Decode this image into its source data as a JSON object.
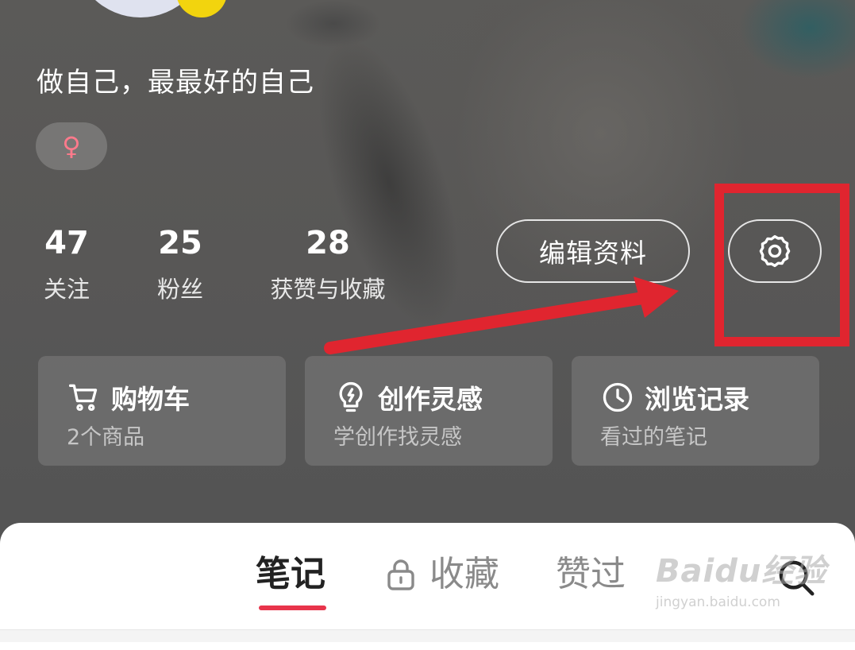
{
  "profile": {
    "bio": "做自己，最最好的自己",
    "gender_symbol": "♀",
    "gender_color": "#ff7a8c"
  },
  "stats": [
    {
      "value": "47",
      "label": "关注"
    },
    {
      "value": "25",
      "label": "粉丝"
    },
    {
      "value": "28",
      "label": "获赞与收藏"
    }
  ],
  "actions": {
    "edit_profile": "编辑资料",
    "settings_icon": "gear-icon"
  },
  "annotation": {
    "color": "#e0252f"
  },
  "cards": [
    {
      "icon": "cart-icon",
      "title": "购物车",
      "subtitle": "2个商品"
    },
    {
      "icon": "lightbulb-icon",
      "title": "创作灵感",
      "subtitle": "学创作找灵感"
    },
    {
      "icon": "clock-icon",
      "title": "浏览记录",
      "subtitle": "看过的笔记"
    }
  ],
  "tabs": {
    "notes": "笔记",
    "collections": "收藏",
    "liked": "赞过",
    "active_color": "#e8344b",
    "search_icon": "search-icon"
  },
  "watermark": {
    "main": "Baidu经验",
    "url": "jingyan.baidu.com"
  }
}
